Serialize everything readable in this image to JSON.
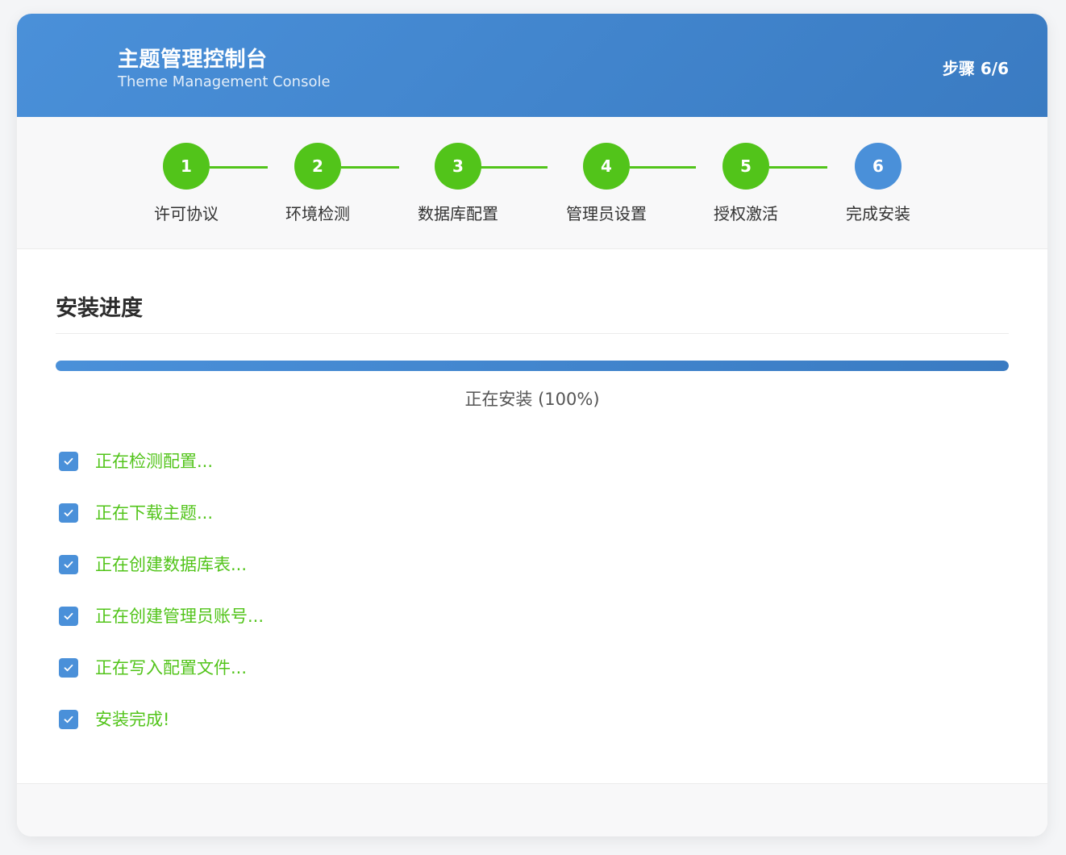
{
  "header": {
    "title": "主题管理控制台",
    "subtitle": "Theme Management Console",
    "step_indicator": "步骤 6/6"
  },
  "steps": [
    {
      "number": "1",
      "label": "许可协议",
      "status": "done"
    },
    {
      "number": "2",
      "label": "环境检测",
      "status": "done"
    },
    {
      "number": "3",
      "label": "数据库配置",
      "status": "done"
    },
    {
      "number": "4",
      "label": "管理员设置",
      "status": "done"
    },
    {
      "number": "5",
      "label": "授权激活",
      "status": "done"
    },
    {
      "number": "6",
      "label": "完成安装",
      "status": "current"
    }
  ],
  "install": {
    "section_title": "安装进度",
    "progress_percent": 100,
    "progress_text": "正在安装 (100%)",
    "tasks": [
      {
        "text": "正在检测配置...",
        "checked": true
      },
      {
        "text": "正在下载主题...",
        "checked": true
      },
      {
        "text": "正在创建数据库表...",
        "checked": true
      },
      {
        "text": "正在创建管理员账号...",
        "checked": true
      },
      {
        "text": "正在写入配置文件...",
        "checked": true
      },
      {
        "text": "安装完成!",
        "checked": true
      }
    ]
  },
  "colors": {
    "primary": "#4a90d9",
    "success": "#52c41a",
    "checkbox": "#4a90d9",
    "check_icon": "check-icon"
  }
}
